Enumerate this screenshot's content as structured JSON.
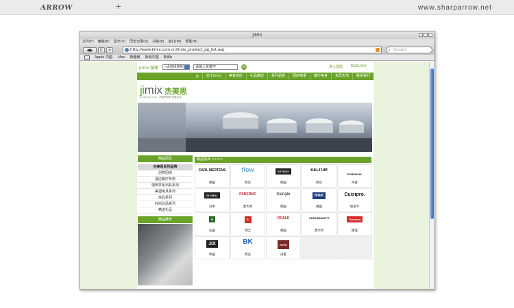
{
  "outer": {
    "logo": "ARROW",
    "plus": "+",
    "site": "www.sharparrow.net"
  },
  "browser": {
    "title": "JIMIX",
    "menu": [
      "文件(F)",
      "编辑(E)",
      "显示(V)",
      "历史记录(S)",
      "书签(B)",
      "窗口(W)",
      "帮助(H)"
    ],
    "nav_labels": {
      "back": "◀",
      "forward": "▶",
      "reload": "C",
      "add": "+"
    },
    "address": "http://www.jimix.com.cn/jimix_product_pp_list.asp",
    "search_placeholder": "Google",
    "bookmarks": [
      "Apple 中国",
      ".Mac",
      "新趣网",
      "新浪中国",
      "新闻▾"
    ]
  },
  "site": {
    "topbar": {
      "logo_text": "jimix 搜索",
      "select": "--请选择类别--",
      "keyword": "请输入关键字",
      "go": "GO",
      "login": "进入登陆",
      "english": "ENGLISH"
    },
    "nav": {
      "home": "⌂",
      "items": [
        "关于jimix",
        "美食商店",
        "礼品精选",
        "系列品牌",
        "厨房物语",
        "餐厅美食",
        "会员天地",
        "联系我们"
      ]
    },
    "brand": {
      "j": "ji",
      "m": "mix",
      "cn": "杰美思",
      "sub": "a culinary mix · 杰美思厨房·品味生活"
    },
    "sidebar": {
      "head": "精品厨具",
      "sub": "杰美思系列品牌",
      "items": [
        "创意厨房",
        "酒店餐厅专用",
        "咖啡茶系列具系列",
        "美酒用具系列",
        "烧具系列",
        "时尚饮品系列",
        "精选礼品"
      ],
      "head2": "精品推荐"
    },
    "main": {
      "head": "精品厨具 >>>>",
      "brands": [
        {
          "name": "CARL MERTENS",
          "country": "德国"
        },
        {
          "name": "flow",
          "country": "荷兰"
        },
        {
          "name": "EZYDOX",
          "country": "德国"
        },
        {
          "name": "KELTUM",
          "country": "荷兰"
        },
        {
          "name": "ROSENDAHL",
          "country": "丹麦"
        },
        {
          "name": "GLOBAL",
          "country": "日本"
        },
        {
          "name": "PADERNO",
          "country": "意大利"
        },
        {
          "name": "triangle",
          "country": "德国"
        },
        {
          "name": "B/R/K",
          "country": "德国"
        },
        {
          "name": "Cuisipro.",
          "country": "加拿大"
        },
        {
          "name": "≋",
          "country": "法国"
        },
        {
          "name": "＋",
          "country": "瑞士"
        },
        {
          "name": "RÖSLE",
          "country": "德国"
        },
        {
          "name": "CASA BUGATTI",
          "country": "意大利"
        },
        {
          "name": "Tescoma",
          "country": "捷克"
        },
        {
          "name": "JIX",
          "country": "中国"
        },
        {
          "name": "BK",
          "country": "荷兰"
        },
        {
          "name": "menu",
          "country": "丹麦"
        }
      ]
    }
  }
}
